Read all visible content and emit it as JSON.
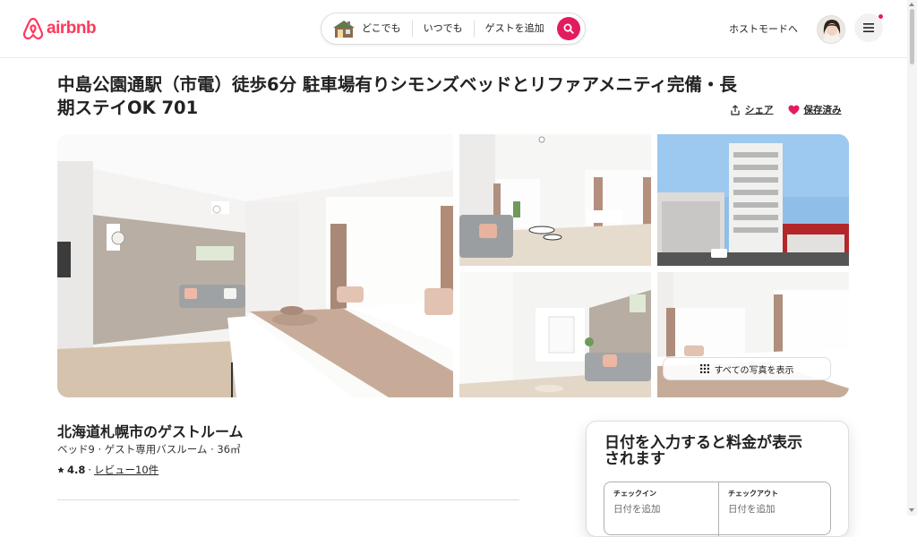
{
  "header": {
    "logo_text": "airbnb",
    "search": {
      "where": "どこでも",
      "when": "いつでも",
      "guests": "ゲストを追加"
    },
    "host_mode": "ホストモードへ"
  },
  "listing": {
    "title": "中島公園通駅（市電）徒歩6分 駐車場有りシモンズベッドとリファアメニティ完備・長期ステイOK 701",
    "share": "シェア",
    "saved": "保存済み",
    "show_all_photos": "すべての写真を表示",
    "subtitle": "北海道札幌市のゲストルーム",
    "details": "ベッド9 · ゲスト専用バスルーム · 36㎡",
    "rating": "4.8",
    "rating_sep": "·",
    "reviews": "レビュー10件"
  },
  "booking": {
    "title": "日付を入力すると料金が表示されます",
    "checkin_label": "チェックイン",
    "checkin_value": "日付を追加",
    "checkout_label": "チェックアウト",
    "checkout_value": "日付を追加"
  },
  "colors": {
    "brand": "#ff385c",
    "search_button": "#e31c5f",
    "saved_heart": "#e31c5f"
  },
  "icons": [
    "airbnb-logo-icon",
    "house-icon",
    "search-icon",
    "menu-icon",
    "share-icon",
    "heart-icon",
    "grid-icon",
    "star-icon"
  ]
}
